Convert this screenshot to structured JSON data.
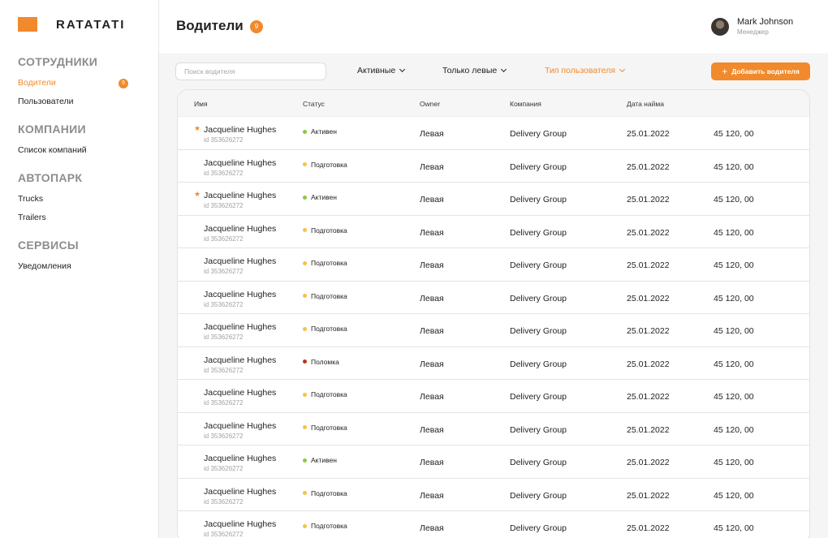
{
  "brand": {
    "name": "RATATATI",
    "logo_color": "#f08a2c"
  },
  "accent_color": "#f08a2c",
  "sidebar": {
    "sections": [
      {
        "title": "СОТРУДНИКИ",
        "items": [
          {
            "label": "Водители",
            "active": true,
            "badge": "9"
          },
          {
            "label": "Пользователи"
          }
        ]
      },
      {
        "title": "КОМПАНИИ",
        "items": [
          {
            "label": "Список компаний"
          }
        ]
      },
      {
        "title": "АВТОПАРК",
        "items": [
          {
            "label": "Trucks"
          },
          {
            "label": "Trailers"
          }
        ]
      },
      {
        "title": "СЕРВИСЫ",
        "items": [
          {
            "label": "Уведомления"
          }
        ]
      }
    ]
  },
  "header": {
    "title": "Водители",
    "count": "9",
    "user": {
      "name": "Mark Johnson",
      "role": "Менеджер"
    }
  },
  "toolbar": {
    "search_placeholder": "Поиск водителя",
    "filters": [
      "Активные",
      "Только левые",
      "Тип пользователя"
    ],
    "add_button": "Добавить водителя",
    "add_icon": "plus-icon"
  },
  "status_colors": {
    "Активен": "#8dc63f",
    "Подготовка": "#f5c343",
    "Поломка": "#b7361f"
  },
  "table": {
    "columns": [
      "Имя",
      "Статус",
      "Owner",
      "Компания",
      "Дата найма",
      ""
    ],
    "rows": [
      {
        "starred": true,
        "name": "Jacqueline Hughes",
        "id": "id 353626272",
        "status": "Активен",
        "owner": "Левая",
        "company": "Delivery Group",
        "hire_date": "25.01.2022",
        "amount": "45 120, 00"
      },
      {
        "starred": false,
        "name": "Jacqueline Hughes",
        "id": "id 353626272",
        "status": "Подготовка",
        "owner": "Левая",
        "company": "Delivery Group",
        "hire_date": "25.01.2022",
        "amount": "45 120, 00"
      },
      {
        "starred": true,
        "name": "Jacqueline Hughes",
        "id": "id 353626272",
        "status": "Активен",
        "owner": "Левая",
        "company": "Delivery Group",
        "hire_date": "25.01.2022",
        "amount": "45 120, 00"
      },
      {
        "starred": false,
        "name": "Jacqueline Hughes",
        "id": "id 353626272",
        "status": "Подготовка",
        "owner": "Левая",
        "company": "Delivery Group",
        "hire_date": "25.01.2022",
        "amount": "45 120, 00"
      },
      {
        "starred": false,
        "name": "Jacqueline Hughes",
        "id": "id 353626272",
        "status": "Подготовка",
        "owner": "Левая",
        "company": "Delivery Group",
        "hire_date": "25.01.2022",
        "amount": "45 120, 00"
      },
      {
        "starred": false,
        "name": "Jacqueline Hughes",
        "id": "id 353626272",
        "status": "Подготовка",
        "owner": "Левая",
        "company": "Delivery Group",
        "hire_date": "25.01.2022",
        "amount": "45 120, 00"
      },
      {
        "starred": false,
        "name": "Jacqueline Hughes",
        "id": "id 353626272",
        "status": "Подготовка",
        "owner": "Левая",
        "company": "Delivery Group",
        "hire_date": "25.01.2022",
        "amount": "45 120, 00"
      },
      {
        "starred": false,
        "name": "Jacqueline Hughes",
        "id": "id 353626272",
        "status": "Поломка",
        "owner": "Левая",
        "company": "Delivery Group",
        "hire_date": "25.01.2022",
        "amount": "45 120, 00"
      },
      {
        "starred": false,
        "name": "Jacqueline Hughes",
        "id": "id 353626272",
        "status": "Подготовка",
        "owner": "Левая",
        "company": "Delivery Group",
        "hire_date": "25.01.2022",
        "amount": "45 120, 00"
      },
      {
        "starred": false,
        "name": "Jacqueline Hughes",
        "id": "id 353626272",
        "status": "Подготовка",
        "owner": "Левая",
        "company": "Delivery Group",
        "hire_date": "25.01.2022",
        "amount": "45 120, 00"
      },
      {
        "starred": false,
        "name": "Jacqueline Hughes",
        "id": "id 353626272",
        "status": "Активен",
        "owner": "Левая",
        "company": "Delivery Group",
        "hire_date": "25.01.2022",
        "amount": "45 120, 00"
      },
      {
        "starred": false,
        "name": "Jacqueline Hughes",
        "id": "id 353626272",
        "status": "Подготовка",
        "owner": "Левая",
        "company": "Delivery Group",
        "hire_date": "25.01.2022",
        "amount": "45 120, 00"
      },
      {
        "starred": false,
        "name": "Jacqueline Hughes",
        "id": "id 353626272",
        "status": "Подготовка",
        "owner": "Левая",
        "company": "Delivery Group",
        "hire_date": "25.01.2022",
        "amount": "45 120, 00"
      }
    ]
  }
}
